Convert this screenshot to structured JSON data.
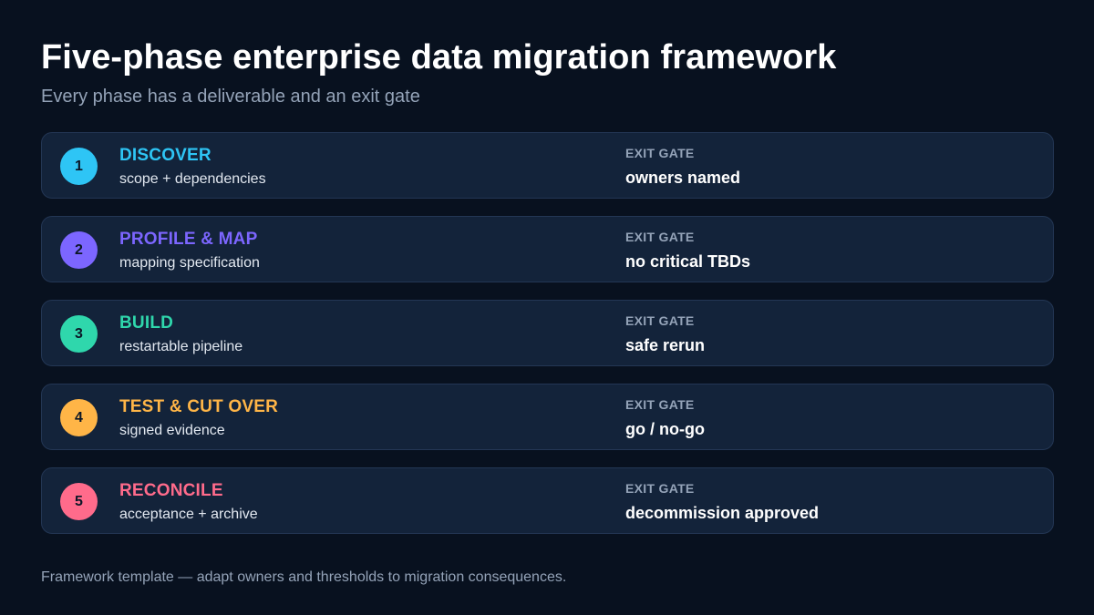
{
  "header": {
    "title": "Five-phase enterprise data migration framework",
    "subtitle": "Every phase has a deliverable and an exit gate"
  },
  "phases": [
    {
      "number": "1",
      "name": "DISCOVER",
      "deliverable": "scope + dependencies",
      "gate_label": "EXIT GATE",
      "gate": "owners named",
      "color": "#2ec5f5"
    },
    {
      "number": "2",
      "name": "PROFILE & MAP",
      "deliverable": "mapping specification",
      "gate_label": "EXIT GATE",
      "gate": "no critical TBDs",
      "color": "#7c66ff"
    },
    {
      "number": "3",
      "name": "BUILD",
      "deliverable": "restartable pipeline",
      "gate_label": "EXIT GATE",
      "gate": "safe rerun",
      "color": "#2fd7ac"
    },
    {
      "number": "4",
      "name": "TEST & CUT OVER",
      "deliverable": "signed evidence",
      "gate_label": "EXIT GATE",
      "gate": "go / no-go",
      "color": "#ffb547"
    },
    {
      "number": "5",
      "name": "RECONCILE",
      "deliverable": "acceptance + archive",
      "gate_label": "EXIT GATE",
      "gate": "decommission approved",
      "color": "#ff6b8b"
    }
  ],
  "footer": {
    "note": "Framework template — adapt owners and thresholds to migration consequences."
  }
}
